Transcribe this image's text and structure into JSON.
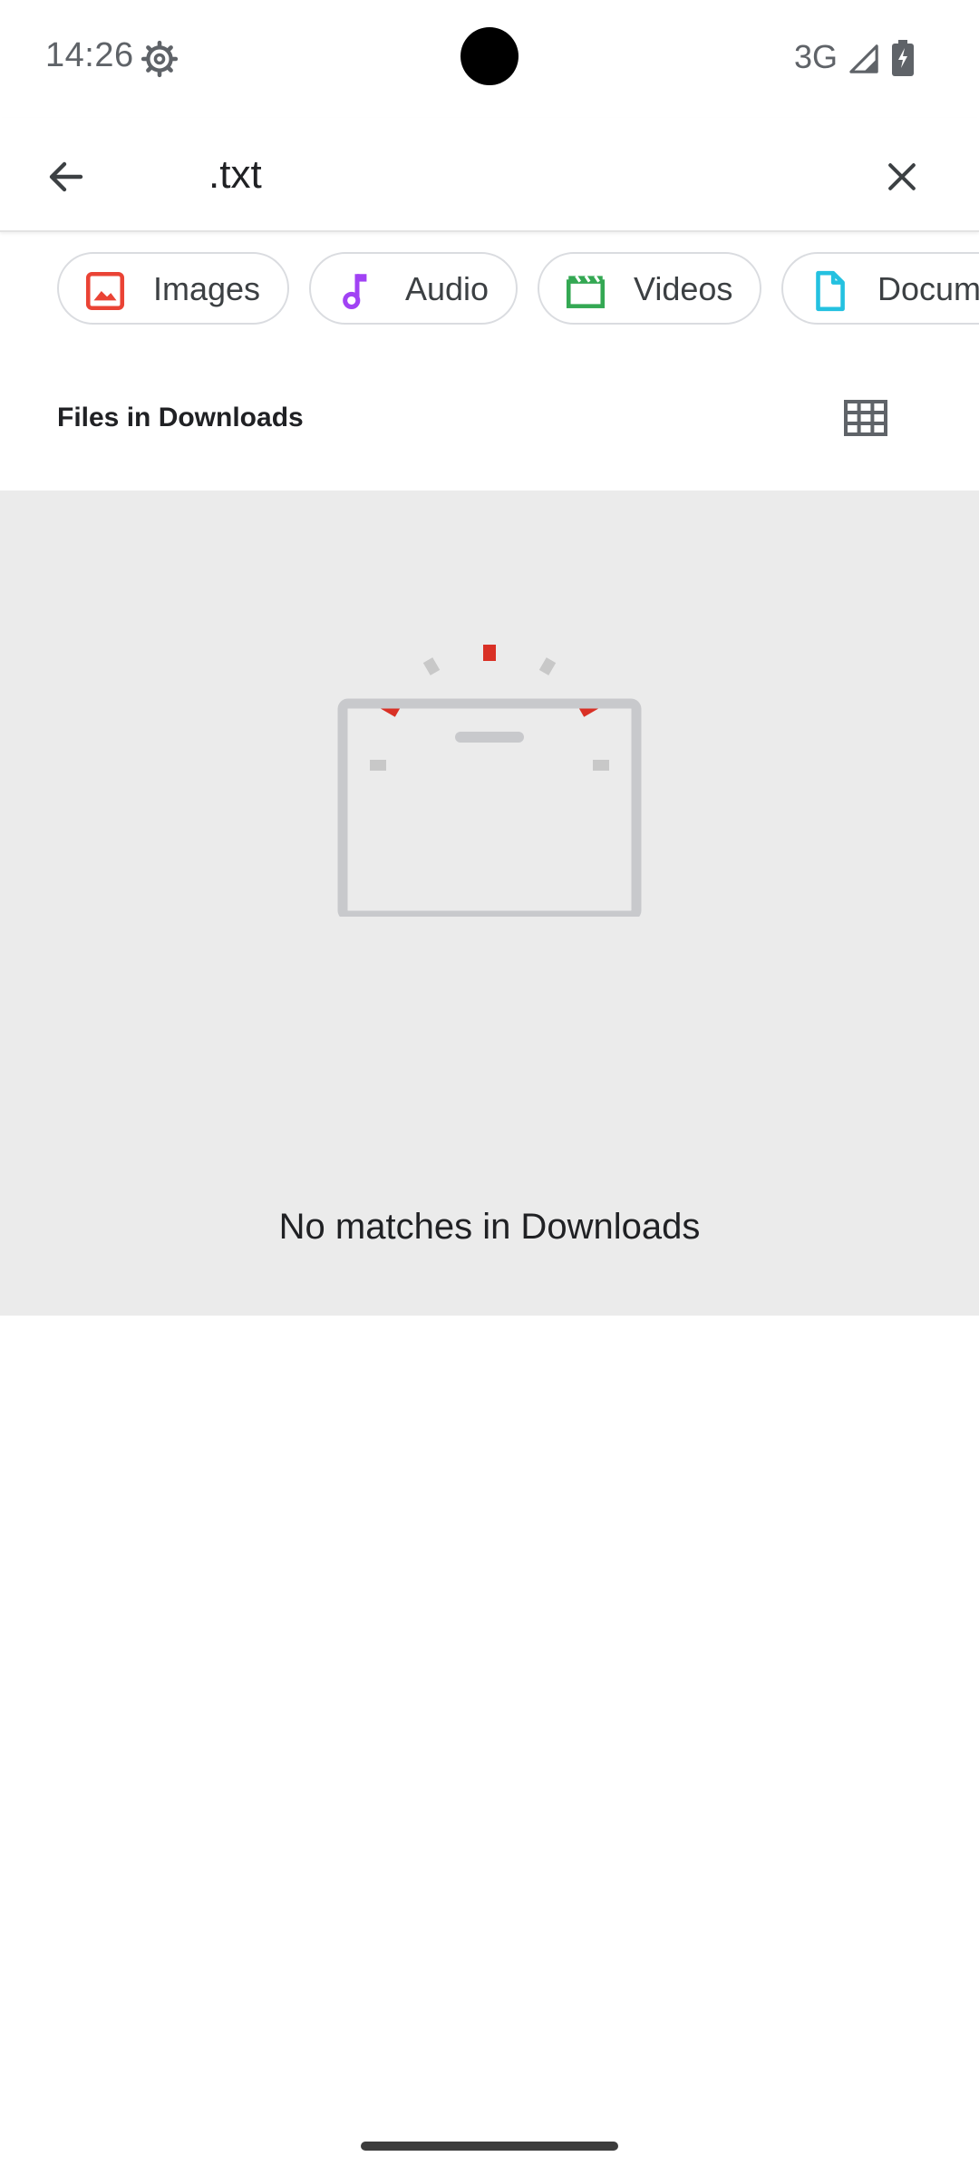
{
  "status_bar": {
    "time": "14:26",
    "network": "3G",
    "icons": [
      "settings-icon",
      "signal-icon",
      "battery-charging-icon"
    ]
  },
  "search": {
    "query": ".txt",
    "back_icon": "arrow-back-icon",
    "clear_icon": "close-icon"
  },
  "chips": [
    {
      "label": "Images",
      "icon": "image-icon",
      "color": "#ea4335"
    },
    {
      "label": "Audio",
      "icon": "music-note-icon",
      "color": "#a142f4"
    },
    {
      "label": "Videos",
      "icon": "video-icon",
      "color": "#34a853"
    },
    {
      "label": "Documents",
      "icon": "document-icon",
      "color": "#24c1e0"
    }
  ],
  "section": {
    "title": "Files in Downloads",
    "view_toggle_icon": "grid-view-icon"
  },
  "empty_state": {
    "message": "No matches in Downloads",
    "accent_color": "#d93025"
  }
}
